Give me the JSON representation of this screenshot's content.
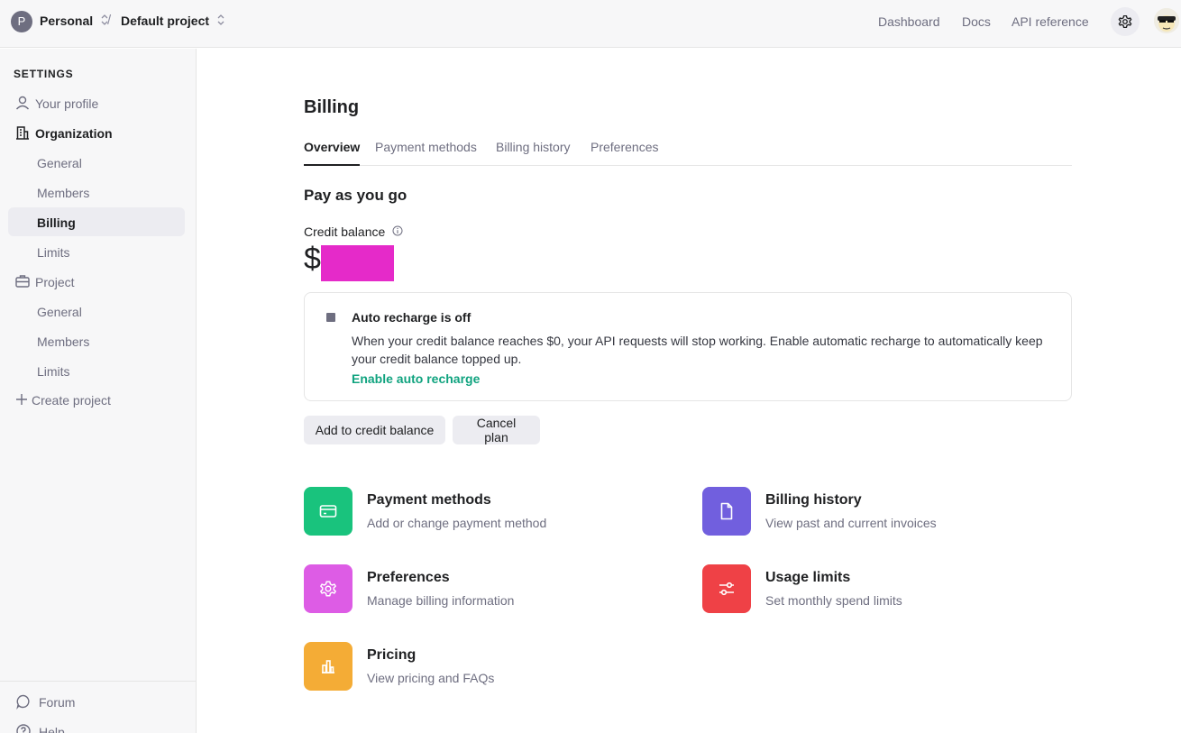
{
  "topbar": {
    "org_initial": "P",
    "org_name": "Personal",
    "separator": "/",
    "project_name": "Default project",
    "nav": [
      "Dashboard",
      "Docs",
      "API reference"
    ]
  },
  "sidebar": {
    "heading": "SETTINGS",
    "your_profile": "Your profile",
    "organization": "Organization",
    "org_items": [
      "General",
      "Members",
      "Billing",
      "Limits"
    ],
    "project": "Project",
    "project_items": [
      "General",
      "Members",
      "Limits"
    ],
    "create_project": "Create project",
    "forum": "Forum",
    "help": "Help"
  },
  "main": {
    "title": "Billing",
    "tabs": [
      "Overview",
      "Payment methods",
      "Billing history",
      "Preferences"
    ],
    "active_tab": "Overview",
    "section_title": "Pay as you go",
    "credit_balance_label": "Credit balance",
    "currency_symbol": "$",
    "notice": {
      "title": "Auto recharge is off",
      "body": "When your credit balance reaches $0, your API requests will stop working. Enable automatic recharge to automatically keep your credit balance topped up.",
      "link": "Enable auto recharge"
    },
    "buttons": {
      "add": "Add to credit balance",
      "cancel": "Cancel plan"
    },
    "cards": [
      {
        "title": "Payment methods",
        "subtitle": "Add or change payment method",
        "icon": "credit-card-icon",
        "color": "#19c37d"
      },
      {
        "title": "Billing history",
        "subtitle": "View past and current invoices",
        "icon": "document-icon",
        "color": "#715fde"
      },
      {
        "title": "Preferences",
        "subtitle": "Manage billing information",
        "icon": "gear-icon",
        "color": "#dd5ce5"
      },
      {
        "title": "Usage limits",
        "subtitle": "Set monthly spend limits",
        "icon": "sliders-icon",
        "color": "#ef4146"
      },
      {
        "title": "Pricing",
        "subtitle": "View pricing and FAQs",
        "icon": "bar-chart-icon",
        "color": "#f4ac36"
      }
    ]
  },
  "colors": {
    "accent_green": "#10a37f",
    "redaction": "#e52ac9"
  }
}
